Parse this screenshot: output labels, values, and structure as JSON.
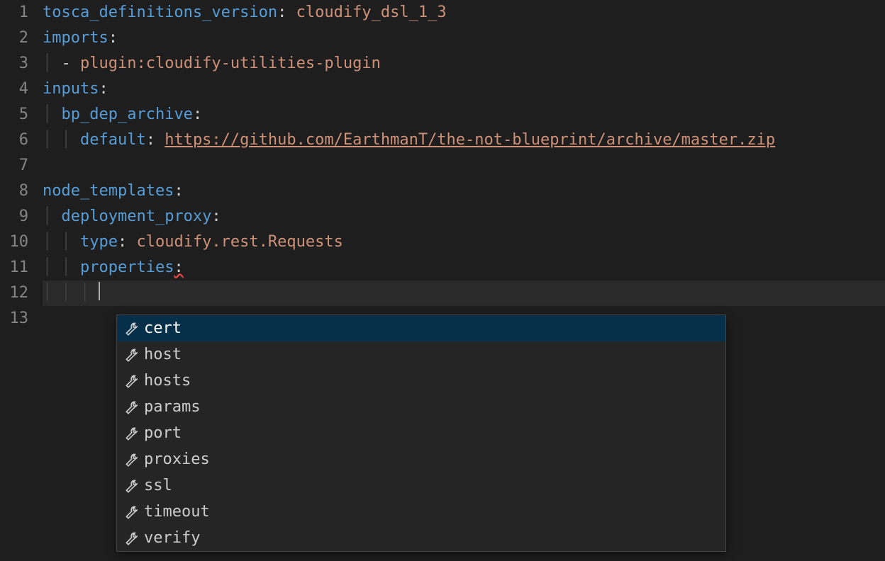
{
  "gutter": [
    "1",
    "2",
    "3",
    "4",
    "5",
    "6",
    "7",
    "8",
    "9",
    "10",
    "11",
    "12",
    "13"
  ],
  "code": {
    "l1_key": "tosca_definitions_version",
    "l1_val": "cloudify_dsl_1_3",
    "l2_key": "imports",
    "l3_val": "plugin:cloudify-utilities-plugin",
    "l4_key": "inputs",
    "l5_key": "bp_dep_archive",
    "l6_key": "default",
    "l6_val": "https://github.com/EarthmanT/the-not-blueprint/archive/master.zip",
    "l8_key": "node_templates",
    "l9_key": "deployment_proxy",
    "l10_key": "type",
    "l10_val": "cloudify.rest.Requests",
    "l11_key": "properties"
  },
  "suggest": {
    "items": [
      {
        "label": "cert"
      },
      {
        "label": "host"
      },
      {
        "label": "hosts"
      },
      {
        "label": "params"
      },
      {
        "label": "port"
      },
      {
        "label": "proxies"
      },
      {
        "label": "ssl"
      },
      {
        "label": "timeout"
      },
      {
        "label": "verify"
      }
    ],
    "selectedIndex": 0
  }
}
